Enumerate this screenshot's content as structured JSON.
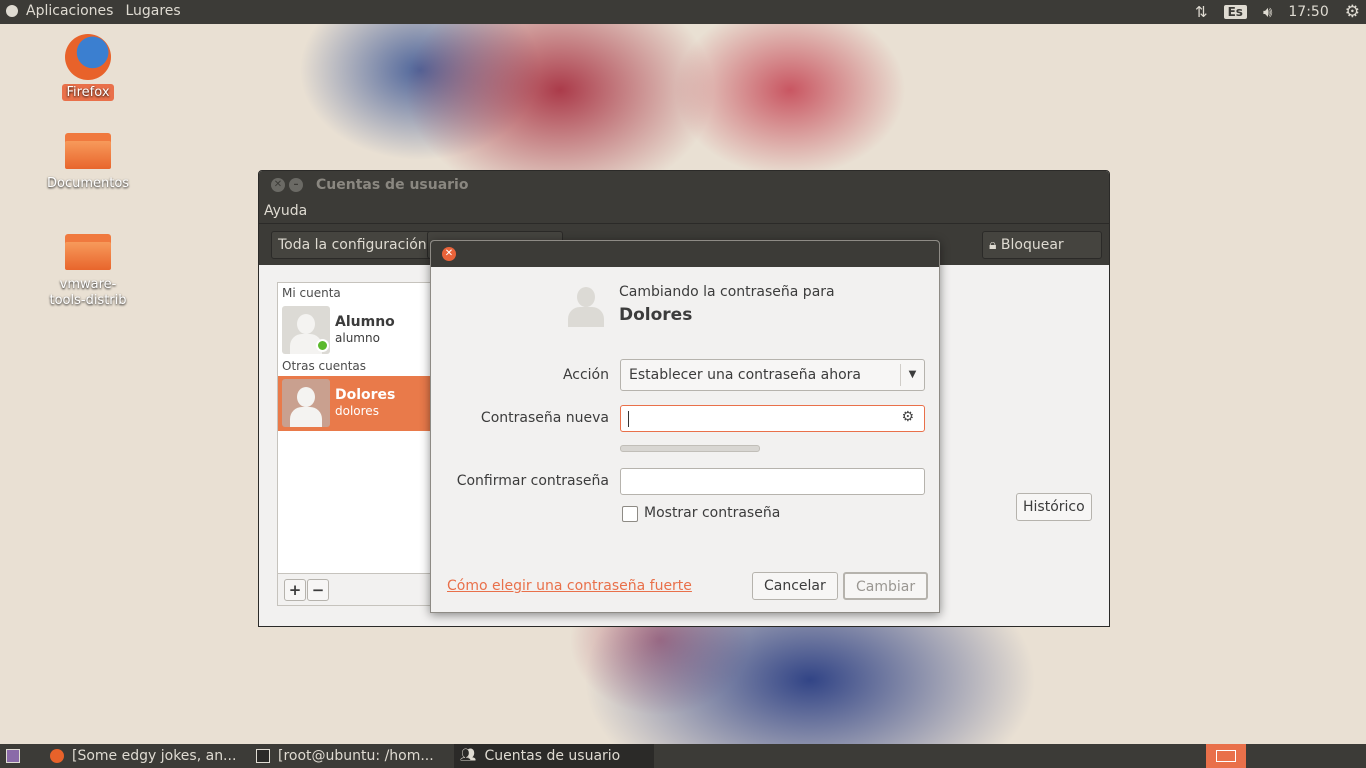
{
  "topbar": {
    "applications": "Aplicaciones",
    "places": "Lugares",
    "keyboard": "Es",
    "clock": "17:50"
  },
  "desktop": {
    "icons": [
      {
        "label": "Firefox"
      },
      {
        "label": "Documentos"
      },
      {
        "label": "vmware-tools-distrib"
      }
    ]
  },
  "main_window": {
    "title": "Cuentas de usuario",
    "menu": {
      "help": "Ayuda"
    },
    "toolbar": {
      "all_settings": "Toda la configuración",
      "lock": "Bloquear"
    },
    "sidebar": {
      "my_account_header": "Mi cuenta",
      "other_accounts_header": "Otras cuentas",
      "users": [
        {
          "name": "Alumno",
          "login": "alumno"
        },
        {
          "name": "Dolores",
          "login": "dolores"
        }
      ]
    },
    "history_button": "Histórico",
    "add_label": "+",
    "remove_label": "−"
  },
  "dialog": {
    "subtitle": "Cambiando la contraseña para",
    "user": "Dolores",
    "action_label": "Acción",
    "action_value": "Establecer una contraseña ahora",
    "new_password_label": "Contraseña nueva",
    "confirm_label": "Confirmar contraseña",
    "show_password_label": "Mostrar contraseña",
    "strong_password_link": "Cómo elegir una contraseña fuerte",
    "cancel": "Cancelar",
    "change": "Cambiar"
  },
  "taskbar": {
    "items": [
      {
        "label": "[Some edgy jokes, an..."
      },
      {
        "label": "[root@ubuntu: /hom..."
      },
      {
        "label": "Cuentas de usuario"
      }
    ]
  }
}
